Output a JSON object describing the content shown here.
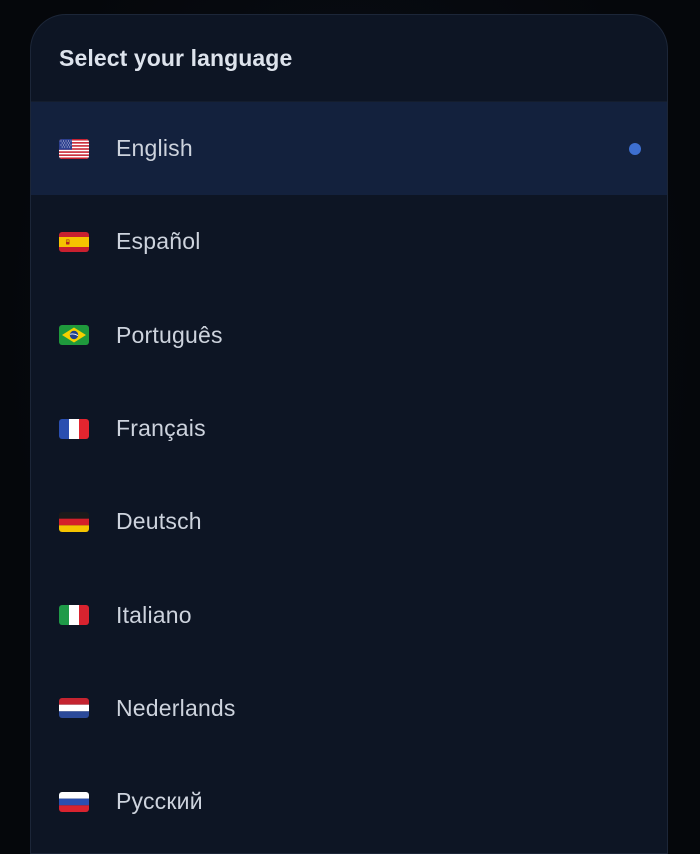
{
  "dialog": {
    "title": "Select your language"
  },
  "languages": [
    {
      "label": "English",
      "flag": "us-flag-icon",
      "selected": true
    },
    {
      "label": "Español",
      "flag": "spain-flag-icon",
      "selected": false
    },
    {
      "label": "Português",
      "flag": "brazil-flag-icon",
      "selected": false
    },
    {
      "label": "Français",
      "flag": "france-flag-icon",
      "selected": false
    },
    {
      "label": "Deutsch",
      "flag": "germany-flag-icon",
      "selected": false
    },
    {
      "label": "Italiano",
      "flag": "italy-flag-icon",
      "selected": false
    },
    {
      "label": "Nederlands",
      "flag": "netherlands-flag-icon",
      "selected": false
    },
    {
      "label": "Русский",
      "flag": "russia-flag-icon",
      "selected": false
    }
  ],
  "colors": {
    "panel_bg": "#0d1524",
    "selected_row_bg": "#13213d",
    "selected_dot": "#3d6fd0",
    "text": "#cdd3dd"
  }
}
